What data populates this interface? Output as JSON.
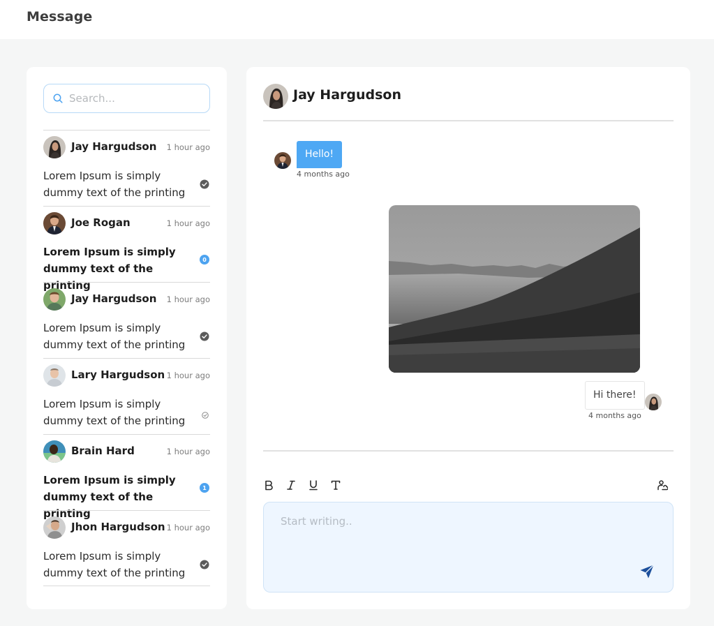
{
  "header": {
    "title": "Message"
  },
  "search": {
    "placeholder": "Search..."
  },
  "conversations": [
    {
      "name": "Jay Hargudson",
      "time": "1 hour ago",
      "message": "Lorem Ipsum is simply dummy text of the printing",
      "unread": false,
      "status": "read"
    },
    {
      "name": "Joe Rogan",
      "time": "1 hour ago",
      "message": "Lorem Ipsum is simply dummy text of the printing",
      "unread": true,
      "badge": "0"
    },
    {
      "name": "Jay Hargudson",
      "time": "1 hour ago",
      "message": "Lorem Ipsum is simply dummy text of the printing",
      "unread": false,
      "status": "read"
    },
    {
      "name": "Lary Hargudson",
      "time": "1 hour ago",
      "message": "Lorem Ipsum is simply dummy text of the printing",
      "unread": false,
      "status": "sent"
    },
    {
      "name": "Brain Hard",
      "time": "1 hour ago",
      "message": "Lorem Ipsum is simply dummy text of the printing",
      "unread": true,
      "badge": "1"
    },
    {
      "name": "Jhon Hargudson",
      "time": "1 hour ago",
      "message": "Lorem Ipsum is simply dummy text of the printing",
      "unread": false,
      "status": "read"
    }
  ],
  "chat": {
    "contact_name": "Jay Hargudson",
    "messages": [
      {
        "direction": "incoming",
        "text": "Hello!",
        "time": "4 months ago"
      },
      {
        "direction": "outgoing",
        "type": "image",
        "icon": "mountain-landscape-photo"
      },
      {
        "direction": "outgoing",
        "text": "Hi there!",
        "time": "4 months ago"
      }
    ]
  },
  "composer": {
    "placeholder": "Start writing..",
    "tools": [
      "bold-icon",
      "italic-icon",
      "underline-icon",
      "text-icon",
      "mention-icon"
    ],
    "send_icon": "send-icon"
  },
  "colors": {
    "accent": "#4ea8f4",
    "badge": "#4da3f0",
    "composer_bg": "#eef6ff",
    "send": "#1c4f9c",
    "page_bg": "#f5f6f6"
  }
}
